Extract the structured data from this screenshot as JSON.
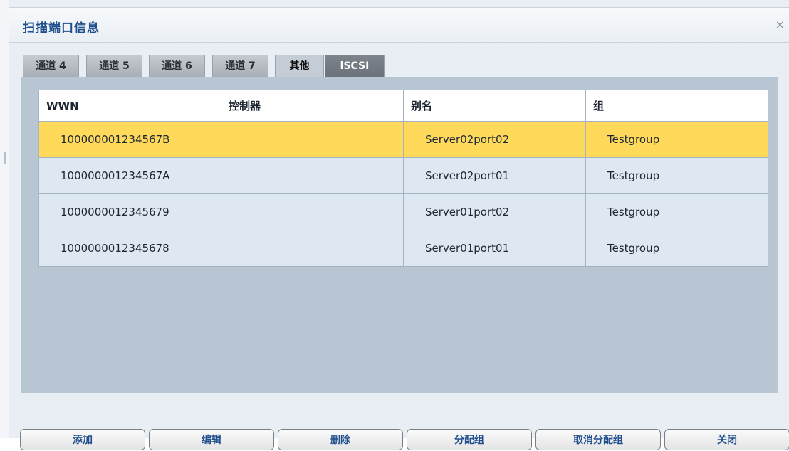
{
  "dialog": {
    "title": "扫描端口信息",
    "close_symbol": "×"
  },
  "tabs": [
    {
      "label": "通道 4",
      "active": false
    },
    {
      "label": "通道 5",
      "active": false
    },
    {
      "label": "通道 6",
      "active": false
    },
    {
      "label": "通道 7",
      "active": false
    },
    {
      "label": "其他",
      "active": true
    },
    {
      "label": "iSCSI",
      "active": false
    }
  ],
  "table": {
    "columns": [
      "WWN",
      "控制器",
      "别名",
      "组"
    ],
    "rows": [
      {
        "wwn": "100000001234567B",
        "controller": "",
        "alias": "Server02port02",
        "group": "Testgroup",
        "selected": true
      },
      {
        "wwn": "100000001234567A",
        "controller": "",
        "alias": "Server02port01",
        "group": "Testgroup",
        "selected": false
      },
      {
        "wwn": "1000000012345679",
        "controller": "",
        "alias": "Server01port02",
        "group": "Testgroup",
        "selected": false
      },
      {
        "wwn": "1000000012345678",
        "controller": "",
        "alias": "Server01port01",
        "group": "Testgroup",
        "selected": false
      }
    ]
  },
  "buttons": {
    "add": "添加",
    "edit": "编辑",
    "delete": "删除",
    "assign_group": "分配组",
    "unassign_group": "取消分配组",
    "close": "关闭"
  },
  "colors": {
    "title": "#1f4e8c",
    "selected_row": "#ffd95a",
    "row": "#dde8f2",
    "panel": "#b8c5d2"
  }
}
